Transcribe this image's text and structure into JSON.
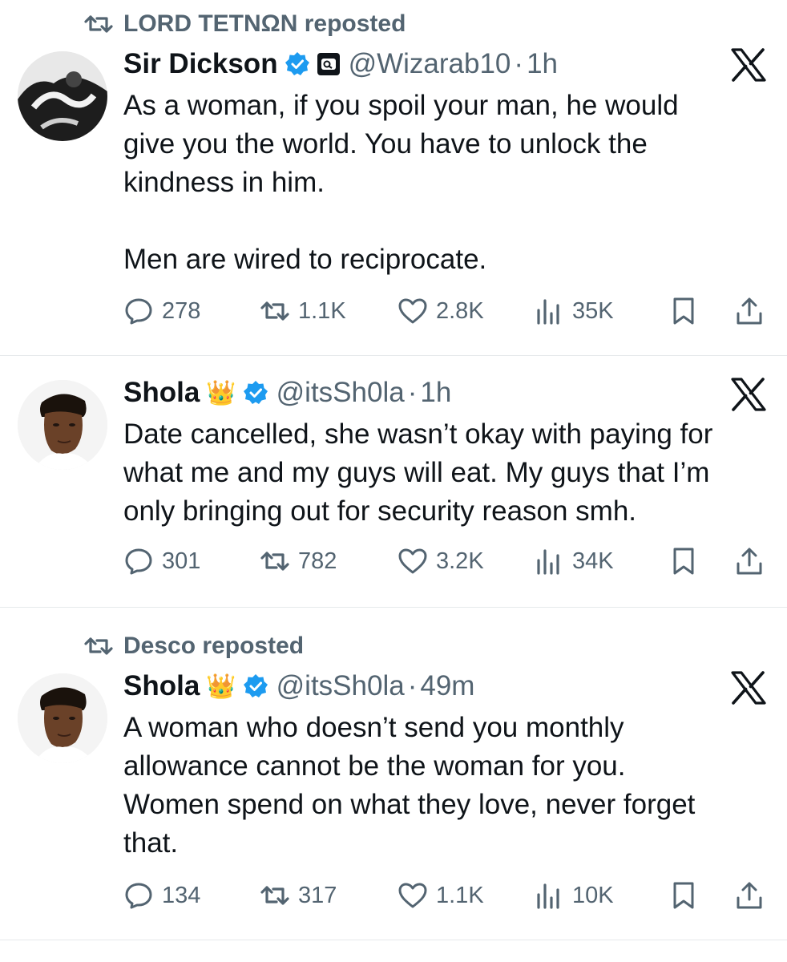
{
  "tweets": [
    {
      "reposted_by": "LORD TETNΩN reposted",
      "name": "Sir Dickson",
      "handle": "@Wizarab10",
      "time": "1h",
      "lines": [
        "As a woman, if you spoil your man, he would",
        "give you the world. You have to unlock the",
        "kindness in him.",
        "",
        "Men are wired to reciprocate."
      ],
      "stats": {
        "replies": "278",
        "reposts": "1.1K",
        "likes": "2.8K",
        "views": "35K"
      }
    },
    {
      "name": "Shola",
      "crown": "👑",
      "handle": "@itsSh0la",
      "time": "1h",
      "lines": [
        "Date cancelled, she wasn’t okay with paying for",
        "what me and my guys will eat. My guys that I’m",
        "only bringing out for security reason smh."
      ],
      "stats": {
        "replies": "301",
        "reposts": "782",
        "likes": "3.2K",
        "views": "34K"
      }
    },
    {
      "reposted_by": "Desco reposted",
      "name": "Shola",
      "crown": "👑",
      "handle": "@itsSh0la",
      "time": "49m",
      "lines": [
        "A woman who doesn’t send you monthly",
        "allowance cannot be the woman for you.",
        "Women spend on what they love, never forget",
        "that."
      ],
      "stats": {
        "replies": "134",
        "reposts": "317",
        "likes": "1.1K",
        "views": "10K"
      }
    }
  ],
  "colors": {
    "text": "#0f1419",
    "muted": "#536471",
    "verified": "#1d9bf0",
    "divider": "#e6e9eb"
  },
  "icons": [
    "repost-icon",
    "verified-badge-icon",
    "affiliate-badge-icon",
    "x-logo-icon",
    "reply-icon",
    "like-icon",
    "views-icon",
    "bookmark-icon",
    "share-icon"
  ]
}
